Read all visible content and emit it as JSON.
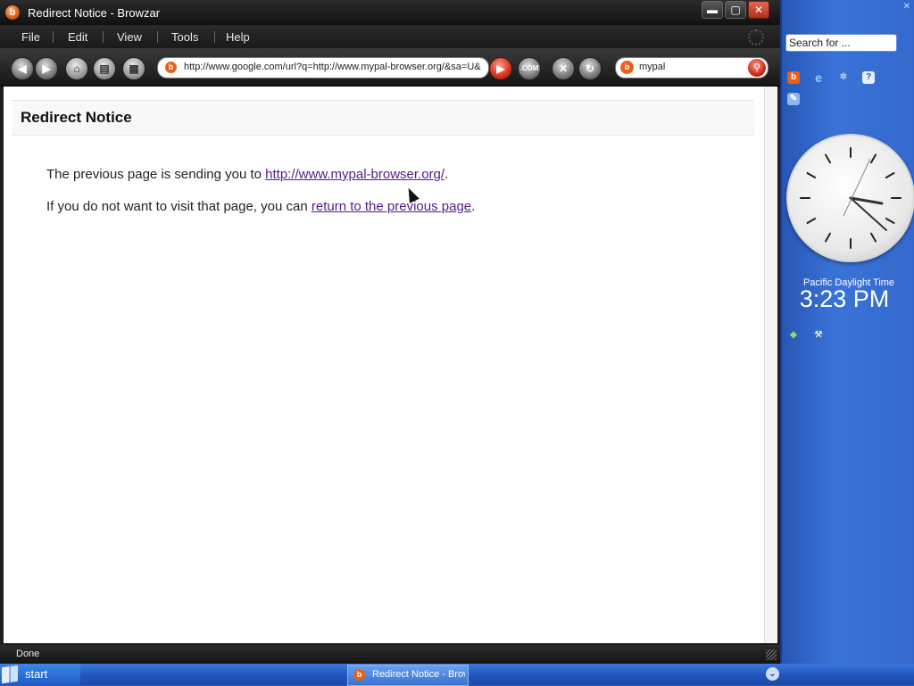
{
  "window": {
    "title": "Redirect Notice - Browzar",
    "app_icon_glyph": "b",
    "controls": {
      "minimize": "▬",
      "maximize": "▢",
      "close": "✕"
    }
  },
  "menu": {
    "items": [
      "File",
      "Edit",
      "View",
      "Tools",
      "Help"
    ]
  },
  "toolbar": {
    "url": "http://www.google.com/url?q=http://www.mypal-browser.org/&sa=U&",
    "search_value": "mypal",
    "go_glyph": "▶",
    "com_label": ".COM",
    "stop_glyph": "✕",
    "refresh_glyph": "↻",
    "back_glyph": "◀",
    "forward_glyph": "▶",
    "home_glyph": "⌂",
    "print_glyph": "▤",
    "history_glyph": "▦",
    "search_glyph": "⚲"
  },
  "page": {
    "title": "Redirect Notice",
    "line1_prefix": "The previous page is sending you to ",
    "line1_link": "http://www.mypal-browser.org/",
    "line1_suffix": ".",
    "line2_prefix": "If you do not want to visit that page, you can ",
    "line2_link": "return to the previous page",
    "line2_suffix": "."
  },
  "status": {
    "text": "Done"
  },
  "sidebar": {
    "close_glyph": "✕",
    "search_placeholder": "Search for ...",
    "timezone": "Pacific Daylight Time",
    "time": "3:23 PM"
  },
  "taskbar": {
    "start_label": "start",
    "task_label": "Redirect Notice - Browzar",
    "chevron_glyph": "⌄"
  },
  "colors": {
    "link_visited": "#551a8b",
    "sidebar_blue": "#2f63c6",
    "taskbar_blue": "#2456c0"
  }
}
